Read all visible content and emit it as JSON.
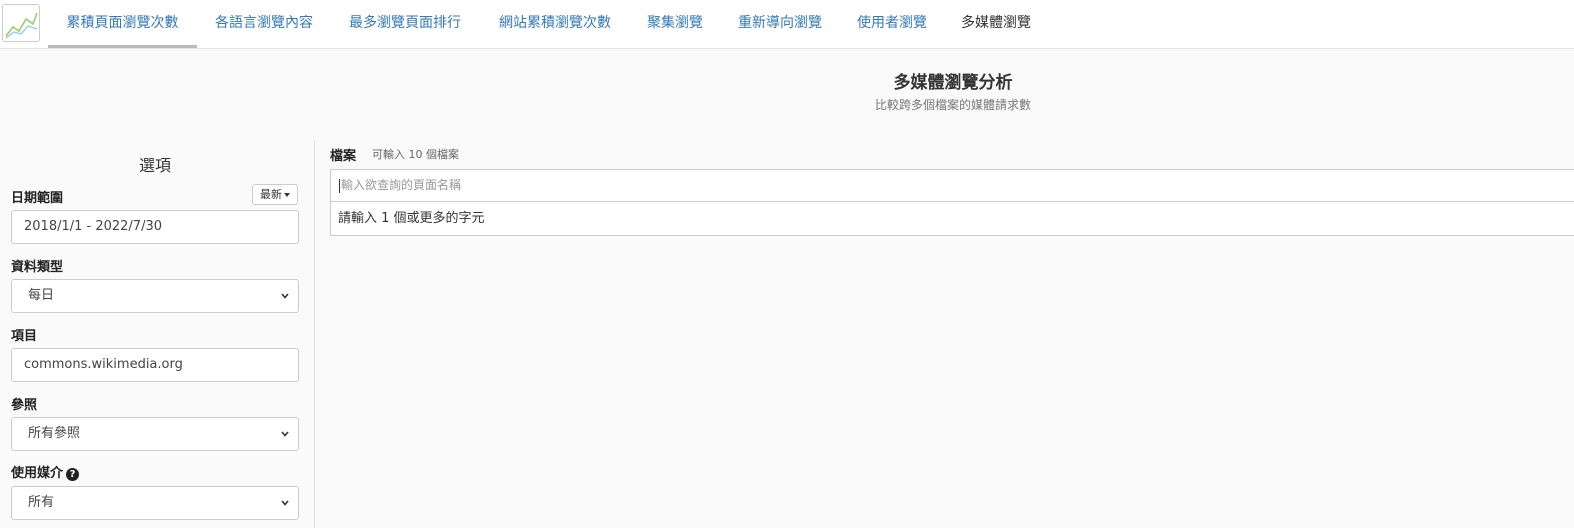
{
  "nav": {
    "tabs": [
      {
        "label": "累積頁面瀏覽次數"
      },
      {
        "label": "各語言瀏覽內容"
      },
      {
        "label": "最多瀏覽頁面排行"
      },
      {
        "label": "網站累積瀏覽次數"
      },
      {
        "label": "聚集瀏覽"
      },
      {
        "label": "重新導向瀏覽"
      },
      {
        "label": "使用者瀏覽"
      },
      {
        "label": "多媒體瀏覽"
      }
    ]
  },
  "header": {
    "title": "多媒體瀏覽分析",
    "subtitle": "比較跨多個檔案的媒體請求數"
  },
  "sidebar": {
    "title": "選項",
    "date_range": {
      "label": "日期範圍",
      "latest_button": "最新",
      "value": "2018/1/1 - 2022/7/30"
    },
    "data_type": {
      "label": "資料類型",
      "value": "每日"
    },
    "project": {
      "label": "項目",
      "value": "commons.wikimedia.org"
    },
    "referer": {
      "label": "參照",
      "value": "所有參照"
    },
    "agent": {
      "label": "使用媒介",
      "value": "所有"
    }
  },
  "main": {
    "files_label": "檔案",
    "files_hint": "可輸入 10 個檔案",
    "search_placeholder": "輸入欲查詢的頁面名稱",
    "search_hint": "請輸入 1 個或更多的字元"
  },
  "colors": {
    "link": "#337ab7",
    "accent_line": "#4caf50"
  }
}
